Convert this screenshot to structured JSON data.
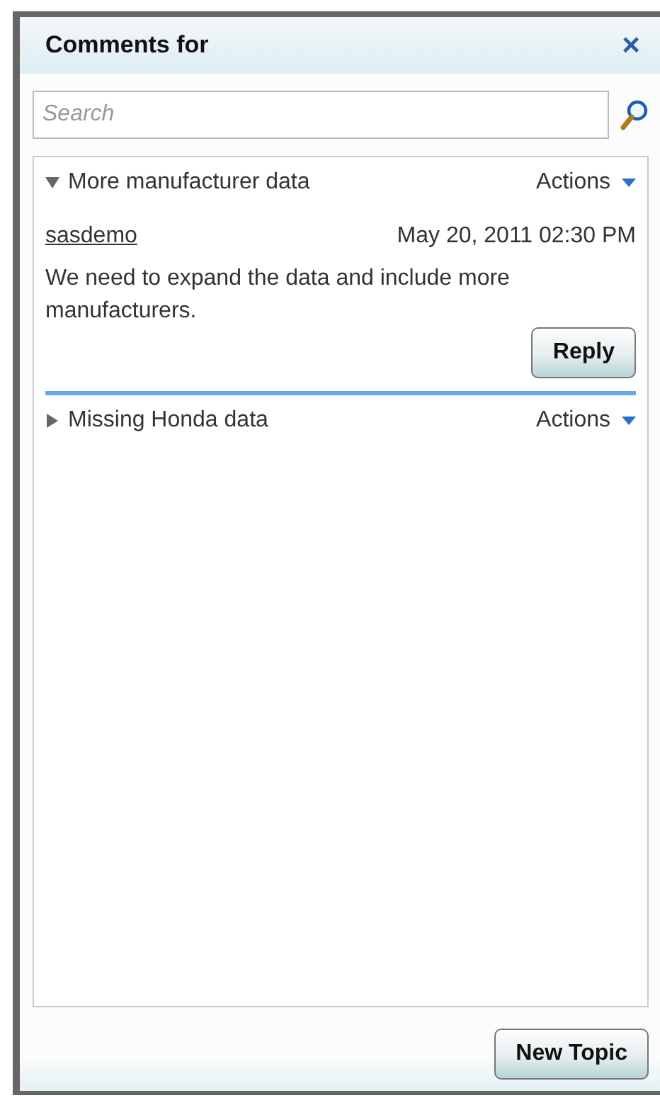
{
  "panel": {
    "title": "Comments for",
    "close": "×"
  },
  "search": {
    "placeholder": "Search"
  },
  "topics": [
    {
      "title": "More manufacturer data",
      "expanded": true,
      "actions": "Actions",
      "comments": [
        {
          "author": "sasdemo",
          "date": "May 20, 2011 02:30 PM",
          "text": "We need to expand the data and include more manufacturers."
        }
      ],
      "reply": "Reply"
    },
    {
      "title": "Missing Honda data",
      "expanded": false,
      "actions": "Actions"
    }
  ],
  "footer": {
    "button": "New Topic"
  }
}
